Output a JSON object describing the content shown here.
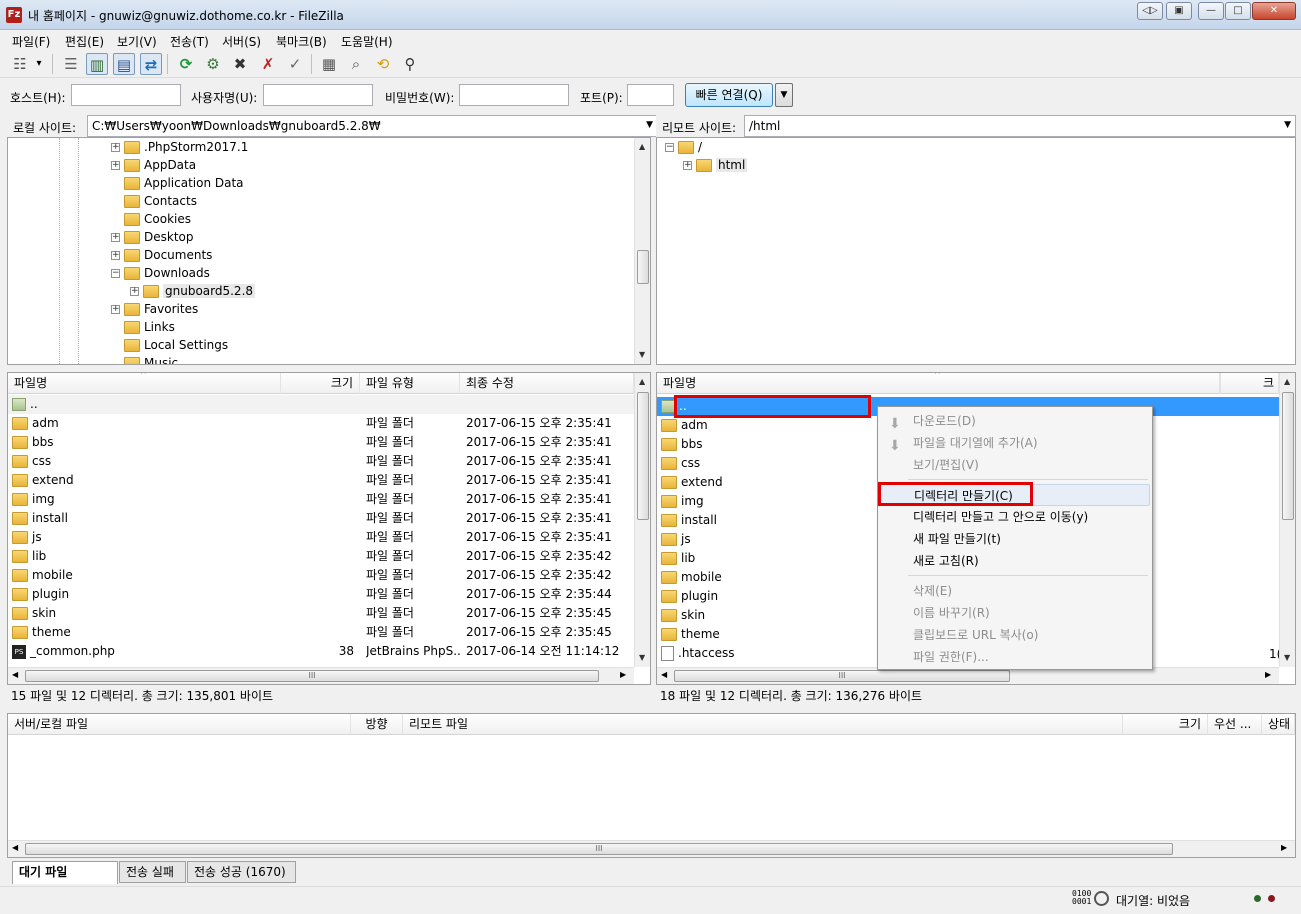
{
  "window": {
    "title": "내 홈페이지 - gnuwiz@gnuwiz.dothome.co.kr - FileZilla",
    "app_icon": "Fz"
  },
  "window_buttons": [
    {
      "name": "back-forward-icon",
      "glyph": "◁▷"
    },
    {
      "name": "restore-tab-icon",
      "glyph": "▣"
    },
    {
      "name": "minimize-icon",
      "glyph": "—"
    },
    {
      "name": "maximize-icon",
      "glyph": "□"
    },
    {
      "name": "close-icon",
      "glyph": "✕"
    }
  ],
  "menu": [
    "파일(F)",
    "편집(E)",
    "보기(V)",
    "전송(T)",
    "서버(S)",
    "북마크(B)",
    "도움말(H)"
  ],
  "toolbar_icons": [
    {
      "name": "site-manager-icon",
      "glyph": "☷"
    },
    {
      "name": "dropdown-arrow-icon",
      "glyph": "▾"
    },
    {
      "name": "message-log-icon",
      "glyph": "☰"
    },
    {
      "name": "local-tree-icon",
      "glyph": "▥"
    },
    {
      "name": "remote-tree-icon",
      "glyph": "▤"
    },
    {
      "name": "transfer-queue-icon",
      "glyph": "⇄"
    },
    {
      "name": "refresh-icon",
      "glyph": "⟳"
    },
    {
      "name": "process-queue-icon",
      "glyph": "⚙"
    },
    {
      "name": "cancel-icon",
      "glyph": "✖"
    },
    {
      "name": "disconnect-icon",
      "glyph": "✗"
    },
    {
      "name": "reconnect-icon",
      "glyph": "✓"
    },
    {
      "name": "directory-listing-filters-icon",
      "glyph": "▦"
    },
    {
      "name": "toggle-comparison-icon",
      "glyph": "⌕"
    },
    {
      "name": "sync-browse-icon",
      "glyph": "⟲"
    },
    {
      "name": "search-icon",
      "glyph": "⚲"
    }
  ],
  "quickconnect": {
    "host_label": "호스트(H):",
    "user_label": "사용자명(U):",
    "pass_label": "비밀번호(W):",
    "port_label": "포트(P):",
    "connect_label": "빠른 연결(Q)",
    "drop_glyph": "▼"
  },
  "local": {
    "site_label": "로컬 사이트:",
    "path": "C:₩Users₩yoon₩Downloads₩gnuboard5.2.8₩",
    "tree": [
      {
        "label": ".PhpStorm2017.1",
        "expander": "+",
        "indent": 0
      },
      {
        "label": "AppData",
        "expander": "+",
        "indent": 0
      },
      {
        "label": "Application Data",
        "expander": "",
        "indent": 0
      },
      {
        "label": "Contacts",
        "expander": "",
        "indent": 0
      },
      {
        "label": "Cookies",
        "expander": "",
        "indent": 0
      },
      {
        "label": "Desktop",
        "expander": "+",
        "indent": 0
      },
      {
        "label": "Documents",
        "expander": "+",
        "indent": 0
      },
      {
        "label": "Downloads",
        "expander": "−",
        "indent": 0
      },
      {
        "label": "gnuboard5.2.8",
        "expander": "+",
        "indent": 1
      },
      {
        "label": "Favorites",
        "expander": "+",
        "indent": 0
      },
      {
        "label": "Links",
        "expander": "",
        "indent": 0
      },
      {
        "label": "Local Settings",
        "expander": "",
        "indent": 0
      },
      {
        "label": "Music",
        "expander": "",
        "indent": 0
      }
    ],
    "columns": [
      "파일명",
      "크기",
      "파일 유형",
      "최종 수정"
    ],
    "files": [
      {
        "name": "..",
        "size": "",
        "type": "",
        "date": "",
        "icon": "up"
      },
      {
        "name": "adm",
        "size": "",
        "type": "파일 폴더",
        "date": "2017-06-15 오후 2:35:41",
        "icon": "folder"
      },
      {
        "name": "bbs",
        "size": "",
        "type": "파일 폴더",
        "date": "2017-06-15 오후 2:35:41",
        "icon": "folder"
      },
      {
        "name": "css",
        "size": "",
        "type": "파일 폴더",
        "date": "2017-06-15 오후 2:35:41",
        "icon": "folder"
      },
      {
        "name": "extend",
        "size": "",
        "type": "파일 폴더",
        "date": "2017-06-15 오후 2:35:41",
        "icon": "folder"
      },
      {
        "name": "img",
        "size": "",
        "type": "파일 폴더",
        "date": "2017-06-15 오후 2:35:41",
        "icon": "folder"
      },
      {
        "name": "install",
        "size": "",
        "type": "파일 폴더",
        "date": "2017-06-15 오후 2:35:41",
        "icon": "folder"
      },
      {
        "name": "js",
        "size": "",
        "type": "파일 폴더",
        "date": "2017-06-15 오후 2:35:41",
        "icon": "folder"
      },
      {
        "name": "lib",
        "size": "",
        "type": "파일 폴더",
        "date": "2017-06-15 오후 2:35:42",
        "icon": "folder"
      },
      {
        "name": "mobile",
        "size": "",
        "type": "파일 폴더",
        "date": "2017-06-15 오후 2:35:42",
        "icon": "folder"
      },
      {
        "name": "plugin",
        "size": "",
        "type": "파일 폴더",
        "date": "2017-06-15 오후 2:35:44",
        "icon": "folder"
      },
      {
        "name": "skin",
        "size": "",
        "type": "파일 폴더",
        "date": "2017-06-15 오후 2:35:45",
        "icon": "folder"
      },
      {
        "name": "theme",
        "size": "",
        "type": "파일 폴더",
        "date": "2017-06-15 오후 2:35:45",
        "icon": "folder"
      },
      {
        "name": "_common.php",
        "size": "38",
        "type": "JetBrains PhpS...",
        "date": "2017-06-14 오전 11:14:12",
        "icon": "ps"
      }
    ],
    "status": "15 파일 및 12 디렉터리. 총 크기: 135,801 바이트"
  },
  "remote": {
    "site_label": "리모트 사이트:",
    "path": "/html",
    "tree": [
      {
        "label": "/",
        "expander": "−",
        "indent": 0
      },
      {
        "label": "html",
        "expander": "+",
        "indent": 1
      }
    ],
    "columns": [
      "파일명",
      "크"
    ],
    "files": [
      {
        "name": "..",
        "icon": "up"
      },
      {
        "name": "adm",
        "icon": "folder"
      },
      {
        "name": "bbs",
        "icon": "folder"
      },
      {
        "name": "css",
        "icon": "folder"
      },
      {
        "name": "extend",
        "icon": "folder"
      },
      {
        "name": "img",
        "icon": "folder"
      },
      {
        "name": "install",
        "icon": "folder"
      },
      {
        "name": "js",
        "icon": "folder"
      },
      {
        "name": "lib",
        "icon": "folder"
      },
      {
        "name": "mobile",
        "icon": "folder"
      },
      {
        "name": "plugin",
        "icon": "folder"
      },
      {
        "name": "skin",
        "icon": "folder"
      },
      {
        "name": "theme",
        "icon": "folder"
      },
      {
        "name": ".htaccess",
        "icon": "file"
      }
    ],
    "partial_size": "1(",
    "status": "18 파일 및 12 디렉터리. 총 크기: 136,276 바이트"
  },
  "context_menu": [
    {
      "label": "다운로드(D)",
      "disabled": true,
      "icon": "⬇"
    },
    {
      "label": "파일을 대기열에 추가(A)",
      "disabled": true,
      "icon": "⬇"
    },
    {
      "label": "보기/편집(V)",
      "disabled": true,
      "icon": ""
    },
    {
      "sep": true
    },
    {
      "label": "디렉터리 만들기(C)",
      "disabled": false,
      "icon": "",
      "highlight": true
    },
    {
      "label": "디렉터리 만들고 그 안으로 이동(y)",
      "disabled": false,
      "icon": ""
    },
    {
      "label": "새 파일 만들기(t)",
      "disabled": false,
      "icon": ""
    },
    {
      "label": "새로 고침(R)",
      "disabled": false,
      "icon": ""
    },
    {
      "sep": true
    },
    {
      "label": "삭제(E)",
      "disabled": true,
      "icon": ""
    },
    {
      "label": "이름 바꾸기(R)",
      "disabled": true,
      "icon": ""
    },
    {
      "label": "클립보드로 URL 복사(o)",
      "disabled": true,
      "icon": ""
    },
    {
      "label": "파일 권한(F)...",
      "disabled": true,
      "icon": ""
    }
  ],
  "queue": {
    "columns": [
      "서버/로컬 파일",
      "방향",
      "리모트 파일",
      "크기",
      "우선 ...",
      "상태"
    ]
  },
  "tabs": [
    "대기 파일",
    "전송 실패",
    "전송 성공 (1670)"
  ],
  "statusbar": {
    "queue": "대기열: 비었음",
    "binary_glyph": "0100\n0001"
  }
}
